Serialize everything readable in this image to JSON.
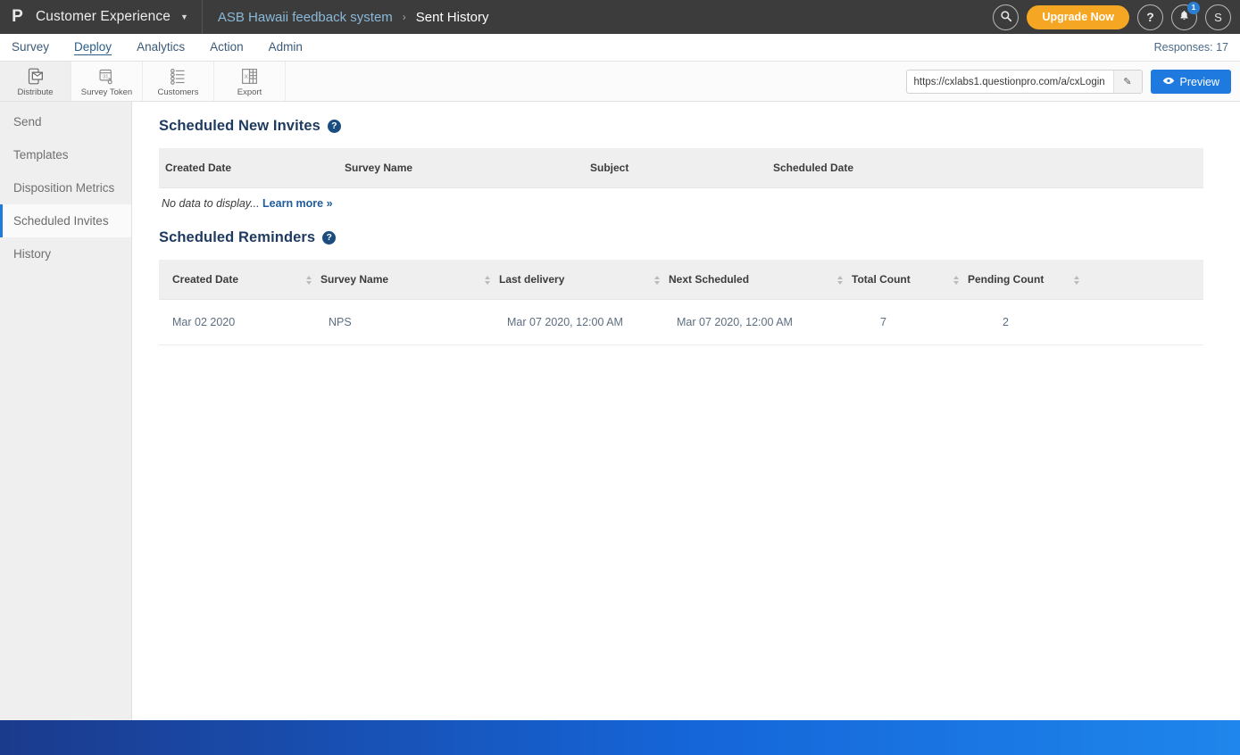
{
  "topbar": {
    "logo_glyph": "P",
    "brand": "Customer Experience",
    "caret": "▼",
    "breadcrumb": {
      "parent": "ASB Hawaii feedback system",
      "separator": "›",
      "current": "Sent History"
    },
    "search_icon_label": "search-icon",
    "upgrade_label": "Upgrade Now",
    "help_glyph": "?",
    "bell_badge": "1",
    "avatar_letter": "S"
  },
  "navbar": {
    "items": [
      {
        "label": "Survey",
        "active": false
      },
      {
        "label": "Deploy",
        "active": true
      },
      {
        "label": "Analytics",
        "active": false
      },
      {
        "label": "Action",
        "active": false
      },
      {
        "label": "Admin",
        "active": false
      }
    ],
    "responses": "Responses: 17"
  },
  "toolbar": {
    "tools": [
      {
        "label": "Distribute",
        "active": true
      },
      {
        "label": "Survey Token",
        "active": false
      },
      {
        "label": "Customers",
        "active": false
      },
      {
        "label": "Export",
        "active": false
      }
    ],
    "url_value": "https://cxlabs1.questionpro.com/a/cxLogin",
    "url_placeholder": "Survey URL",
    "edit_glyph": "✎",
    "preview_label": "Preview"
  },
  "sidebar": {
    "items": [
      {
        "label": "Send",
        "active": false
      },
      {
        "label": "Templates",
        "active": false
      },
      {
        "label": "Disposition Metrics",
        "active": false
      },
      {
        "label": "Scheduled Invites",
        "active": true
      },
      {
        "label": "History",
        "active": false
      }
    ]
  },
  "scheduled_new_invites": {
    "title": "Scheduled New Invites",
    "help_glyph": "?",
    "columns": [
      "Created Date",
      "Survey Name",
      "Subject",
      "Scheduled Date"
    ],
    "empty_text": "No data to display...",
    "empty_link": "Learn more »",
    "rows": []
  },
  "scheduled_reminders": {
    "title": "Scheduled Reminders",
    "help_glyph": "?",
    "columns": [
      "Created Date",
      "Survey Name",
      "Last delivery",
      "Next Scheduled",
      "Total Count",
      "Pending Count",
      ""
    ],
    "rows": [
      {
        "created_date": "Mar 02 2020",
        "survey_name": "NPS",
        "last_delivery": "Mar 07 2020, 12:00 AM",
        "next_scheduled": "Mar 07 2020, 12:00 AM",
        "total_count": "7",
        "pending_count": "2",
        "actions": ""
      }
    ]
  },
  "colors": {
    "topbar_bg": "#3c3c3c",
    "accent_blue": "#1f7ae0",
    "upgrade_orange": "#f5a623",
    "heading_navy": "#1e3a5f",
    "sidebar_bg": "#efefef",
    "footer_gradient_start": "#1b3a8c",
    "footer_gradient_end": "#1e86ec"
  }
}
